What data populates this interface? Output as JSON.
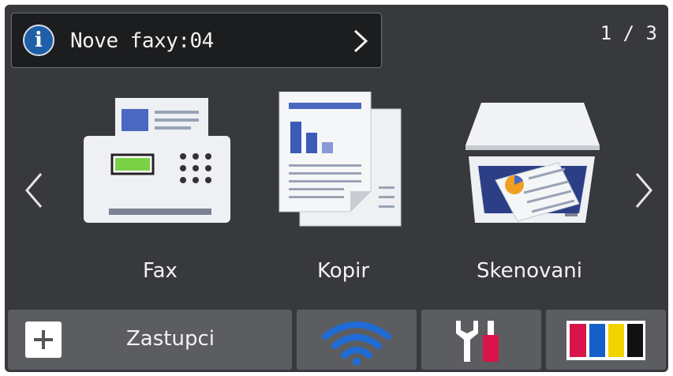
{
  "notification": {
    "text": "Nove faxy:04",
    "icon": "info-icon",
    "action_icon": "chevron-right-icon"
  },
  "pager": {
    "text": "1 / 3"
  },
  "tiles": [
    {
      "label": "Fax",
      "icon": "fax-machine-icon"
    },
    {
      "label": "Kopir",
      "icon": "copy-documents-icon"
    },
    {
      "label": "Skenovani",
      "icon": "scanner-icon"
    }
  ],
  "nav": {
    "prev_icon": "chevron-left-icon",
    "next_icon": "chevron-right-icon"
  },
  "bottom_bar": {
    "shortcuts": {
      "label": "Zastupci",
      "icon": "plus-icon"
    },
    "wifi": {
      "icon": "wifi-icon"
    },
    "tools": {
      "icon": "wrench-screwdriver-icon"
    },
    "ink": {
      "icon": "ink-cartridges-icon",
      "colors": [
        "#d8144a",
        "#1560c8",
        "#f2d300",
        "#111111"
      ]
    }
  },
  "colors": {
    "screen_bg": "#38393c",
    "button_bg": "#5c5d61",
    "accent_blue": "#1560c8"
  }
}
